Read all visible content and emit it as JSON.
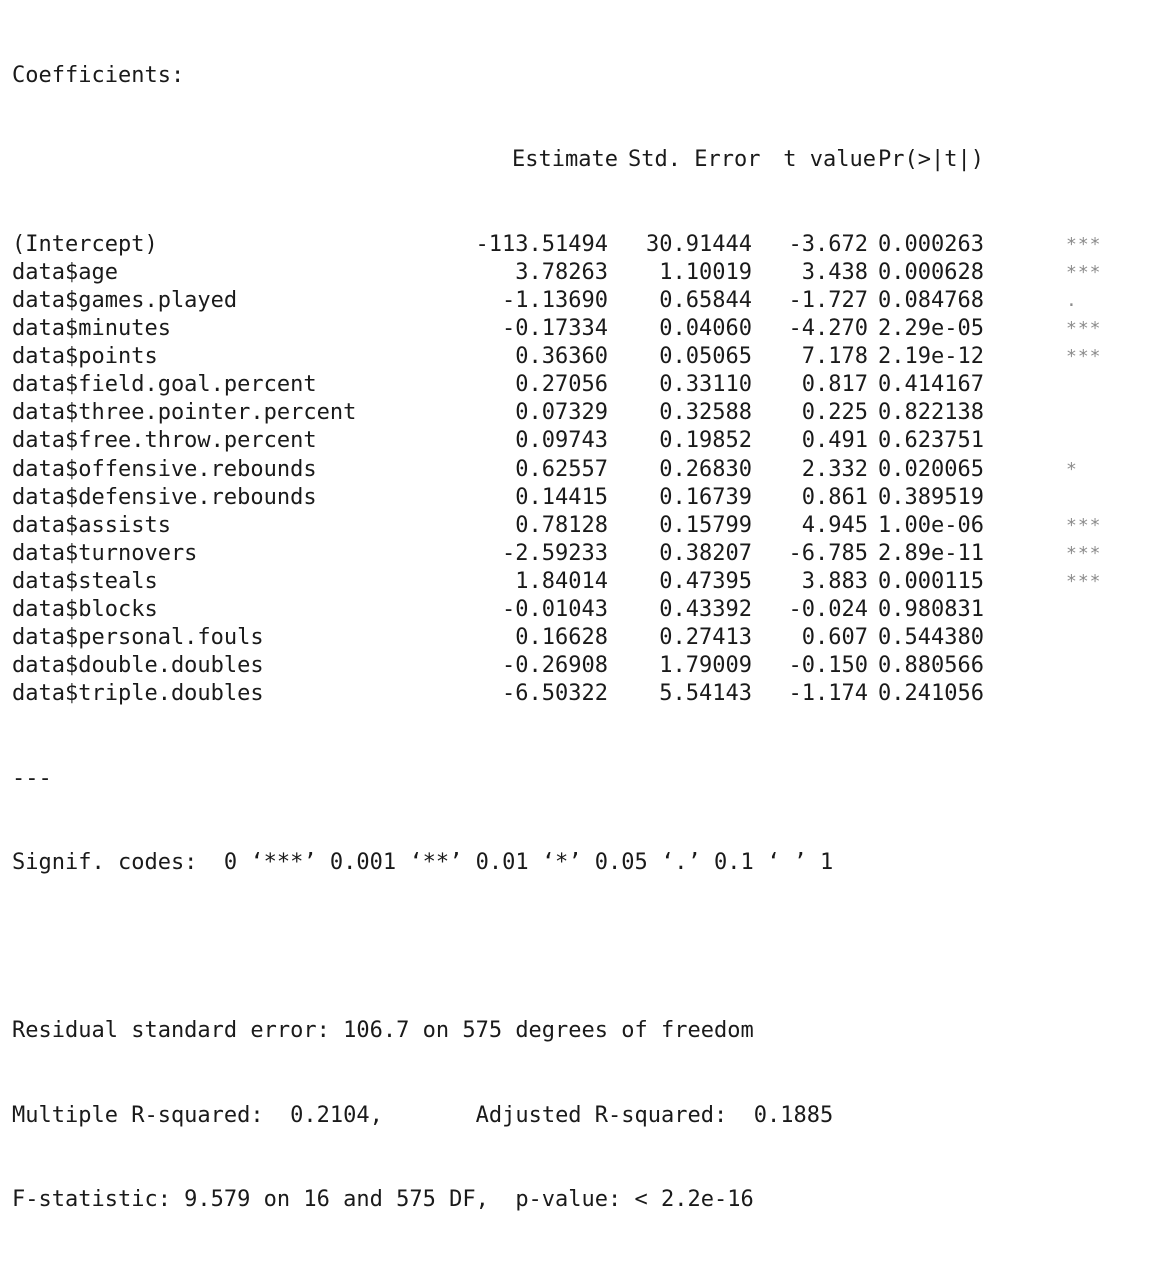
{
  "heading": "Coefficients:",
  "columns": {
    "estimate": "Estimate",
    "std_error": "Std. Error",
    "t_value": "t value",
    "p_value": "Pr(>|t|)"
  },
  "rows": [
    {
      "name": "(Intercept)",
      "estimate": "-113.51494",
      "std_error": "30.91444",
      "t_value": "-3.672",
      "p_value": "0.000263",
      "signif": "***"
    },
    {
      "name": "data$age",
      "estimate": "3.78263",
      "std_error": "1.10019",
      "t_value": "3.438",
      "p_value": "0.000628",
      "signif": "***"
    },
    {
      "name": "data$games.played",
      "estimate": "-1.13690",
      "std_error": "0.65844",
      "t_value": "-1.727",
      "p_value": "0.084768",
      "signif": "."
    },
    {
      "name": "data$minutes",
      "estimate": "-0.17334",
      "std_error": "0.04060",
      "t_value": "-4.270",
      "p_value": "2.29e-05",
      "signif": "***"
    },
    {
      "name": "data$points",
      "estimate": "0.36360",
      "std_error": "0.05065",
      "t_value": "7.178",
      "p_value": "2.19e-12",
      "signif": "***"
    },
    {
      "name": "data$field.goal.percent",
      "estimate": "0.27056",
      "std_error": "0.33110",
      "t_value": "0.817",
      "p_value": "0.414167",
      "signif": ""
    },
    {
      "name": "data$three.pointer.percent",
      "estimate": "0.07329",
      "std_error": "0.32588",
      "t_value": "0.225",
      "p_value": "0.822138",
      "signif": ""
    },
    {
      "name": "data$free.throw.percent",
      "estimate": "0.09743",
      "std_error": "0.19852",
      "t_value": "0.491",
      "p_value": "0.623751",
      "signif": ""
    },
    {
      "name": "data$offensive.rebounds",
      "estimate": "0.62557",
      "std_error": "0.26830",
      "t_value": "2.332",
      "p_value": "0.020065",
      "signif": "*"
    },
    {
      "name": "data$defensive.rebounds",
      "estimate": "0.14415",
      "std_error": "0.16739",
      "t_value": "0.861",
      "p_value": "0.389519",
      "signif": ""
    },
    {
      "name": "data$assists",
      "estimate": "0.78128",
      "std_error": "0.15799",
      "t_value": "4.945",
      "p_value": "1.00e-06",
      "signif": "***"
    },
    {
      "name": "data$turnovers",
      "estimate": "-2.59233",
      "std_error": "0.38207",
      "t_value": "-6.785",
      "p_value": "2.89e-11",
      "signif": "***"
    },
    {
      "name": "data$steals",
      "estimate": "1.84014",
      "std_error": "0.47395",
      "t_value": "3.883",
      "p_value": "0.000115",
      "signif": "***"
    },
    {
      "name": "data$blocks",
      "estimate": "-0.01043",
      "std_error": "0.43392",
      "t_value": "-0.024",
      "p_value": "0.980831",
      "signif": ""
    },
    {
      "name": "data$personal.fouls",
      "estimate": "0.16628",
      "std_error": "0.27413",
      "t_value": "0.607",
      "p_value": "0.544380",
      "signif": ""
    },
    {
      "name": "data$double.doubles",
      "estimate": "-0.26908",
      "std_error": "1.79009",
      "t_value": "-0.150",
      "p_value": "0.880566",
      "signif": ""
    },
    {
      "name": "data$triple.doubles",
      "estimate": "-6.50322",
      "std_error": "5.54143",
      "t_value": "-1.174",
      "p_value": "0.241056",
      "signif": ""
    }
  ],
  "separator": "---",
  "signif_codes": "Signif. codes:  0 ‘***’ 0.001 ‘**’ 0.01 ‘*’ 0.05 ‘.’ 0.1 ‘ ’ 1",
  "summary": {
    "residual": "Residual standard error: 106.7 on 575 degrees of freedom",
    "r_squared": "Multiple R-squared:  0.2104,\tAdjusted R-squared:  0.1885 ",
    "f_statistic": "F-statistic: 9.579 on 16 and 575 DF,  p-value: < 2.2e-16"
  }
}
